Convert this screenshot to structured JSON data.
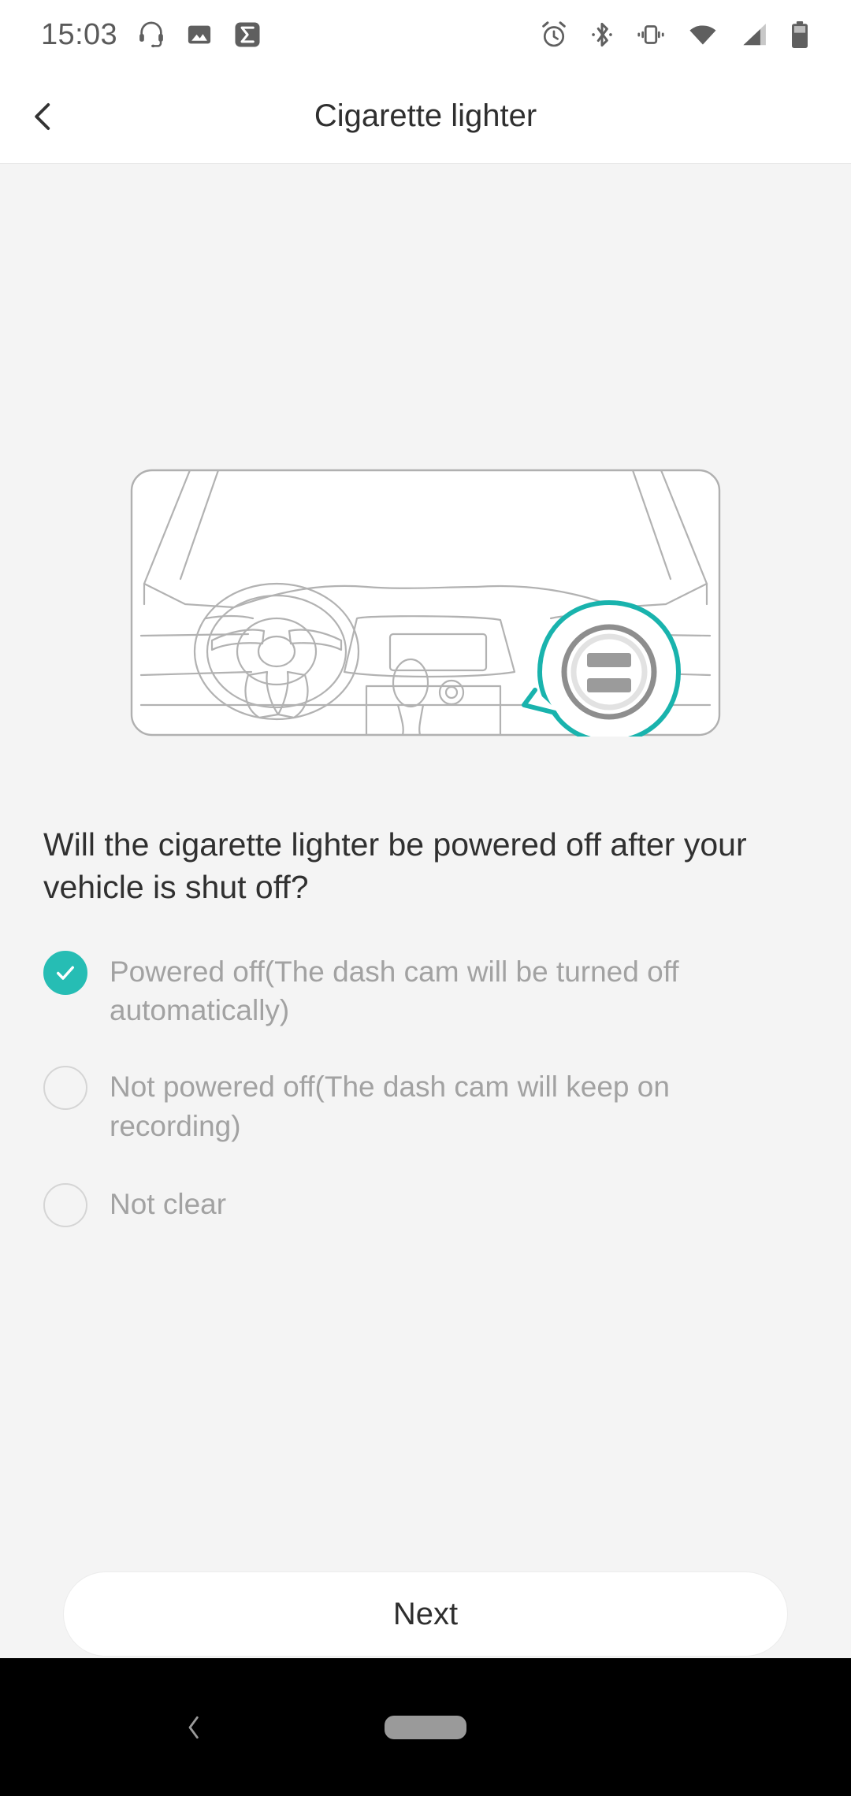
{
  "statusbar": {
    "time": "15:03",
    "left_icons": [
      "headset-icon",
      "photo-icon",
      "sigma-icon"
    ],
    "right_icons": [
      "alarm-icon",
      "bluetooth-icon",
      "vibrate-icon",
      "wifi-icon",
      "cellular-signal-icon",
      "battery-icon"
    ]
  },
  "appbar": {
    "back_icon": "chevron-left-icon",
    "title": "Cigarette lighter"
  },
  "illustration": {
    "name": "car-dashboard-cigarette-lighter-illustration",
    "description": "Line drawing of a car dashboard with steering wheel and a teal callout bubble magnifying the cigarette lighter socket",
    "callout_icon": "cigarette-lighter-socket-icon"
  },
  "question": "Will the cigarette lighter be powered off after your vehicle is shut off?",
  "options": [
    {
      "label": "Powered off(The dash cam will be turned off automatically)",
      "selected": true
    },
    {
      "label": "Not powered off(The dash cam will keep on recording)",
      "selected": false
    },
    {
      "label": "Not clear",
      "selected": false
    }
  ],
  "next_button": {
    "label": "Next"
  },
  "navbar": {
    "back_icon": "chevron-left-icon",
    "home_pill": "home-pill-indicator"
  },
  "colors": {
    "accent_teal": "#26bdb4",
    "page_background": "#f4f4f4",
    "surface_white": "#ffffff",
    "text_primary": "#2f2f2f",
    "text_muted": "#a2a2a2",
    "line_art": "#a8a8a8",
    "navbar_black": "#000000"
  }
}
